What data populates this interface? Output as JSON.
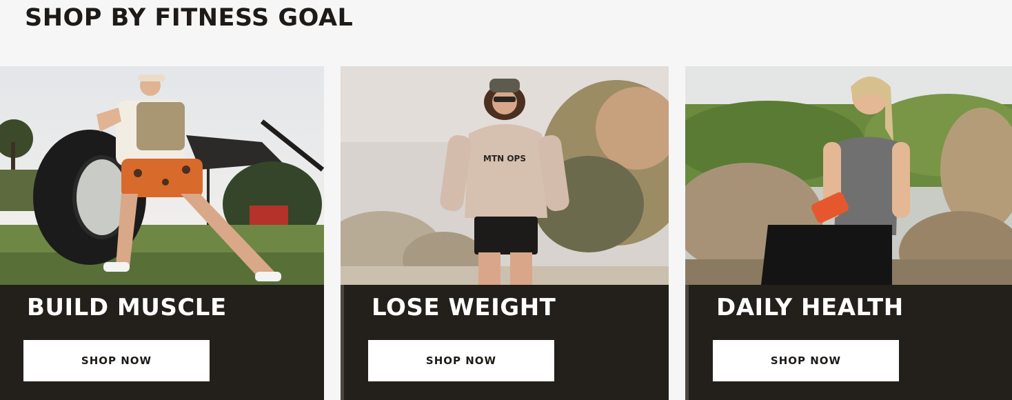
{
  "section": {
    "title": "SHOP BY FITNESS GOAL"
  },
  "cards": [
    {
      "title": "BUILD MUSCLE",
      "button_label": "SHOP NOW",
      "image": "tire-flip-photo"
    },
    {
      "title": "LOSE WEIGHT",
      "button_label": "SHOP NOW",
      "image": "runner-photo",
      "shirt_print": "MTN OPS"
    },
    {
      "title": "DAILY HEALTH",
      "button_label": "SHOP NOW",
      "image": "hiker-resting-photo"
    }
  ],
  "colors": {
    "page_background": "#f6f6f6",
    "card_background": "#231f1b",
    "button_background": "#ffffff",
    "text_dark": "#1d1a17"
  }
}
